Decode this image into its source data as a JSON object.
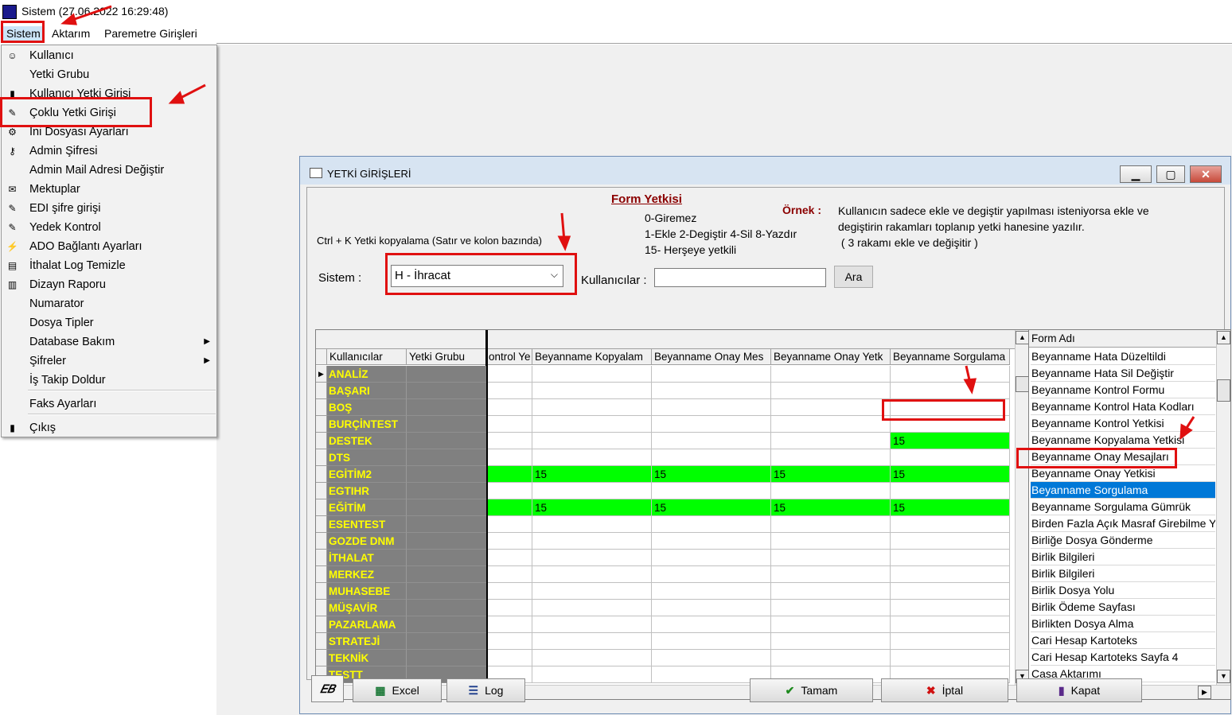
{
  "app": {
    "title": "Sistem (27.06.2022 16:29:48)"
  },
  "menubar": [
    "Sistem",
    "Aktarım",
    "Paremetre Girişleri"
  ],
  "dropdown": [
    {
      "label": "Kullanıcı",
      "icon": "user-icon"
    },
    {
      "label": "Yetki Grubu",
      "icon": ""
    },
    {
      "label": "Kullanıcı Yetki Girişi",
      "icon": "bottle-icon"
    },
    {
      "label": "Çoklu Yetki Girişi",
      "icon": "tools-icon"
    },
    {
      "label": "Ini Dosyası  Ayarları",
      "icon": "settings-icon"
    },
    {
      "label": "Admin Şifresi",
      "icon": "key-icon"
    },
    {
      "label": "Admin Mail Adresi Değiştir",
      "icon": ""
    },
    {
      "label": "Mektuplar",
      "icon": "letter-icon"
    },
    {
      "label": "EDI şifre girişi",
      "icon": "tools-icon"
    },
    {
      "label": "Yedek Kontrol",
      "icon": "tools-icon"
    },
    {
      "label": "ADO Bağlantı Ayarları",
      "icon": "plug-icon"
    },
    {
      "label": "İthalat Log Temizle",
      "icon": "clean-icon"
    },
    {
      "label": "Dizayn Raporu",
      "icon": "report-icon"
    },
    {
      "label": "Numarator",
      "icon": ""
    },
    {
      "label": "Dosya Tipler",
      "icon": ""
    },
    {
      "label": "Database Bakım",
      "icon": "",
      "submenu": true
    },
    {
      "label": "Şifreler",
      "icon": "",
      "submenu": true
    },
    {
      "label": "İş Takip Doldur",
      "icon": ""
    },
    {
      "label": "Faks Ayarları",
      "icon": ""
    },
    {
      "label": "Çıkış",
      "icon": "exit-icon"
    }
  ],
  "dialog": {
    "title": "YETKİ GİRİŞLERİ",
    "form_yetkisi": "Form Yetkisi",
    "legend": [
      "0-Giremez",
      "1-Ekle  2-Degiştir  4-Sil  8-Yazdır",
      "15- Herşeye yetkili"
    ],
    "ornek_label": "Örnek :",
    "ornek_text": [
      "Kullanıcın sadece ekle ve degiştir yapılması isteniyorsa  ekle ve",
      "degiştirin rakamları toplanıp yetki hanesine yazılır.",
      " ( 3 rakamı ekle ve değişitir )"
    ],
    "copy_hint": "Ctrl + K Yetki kopyalama (Satır ve kolon bazında)",
    "sistem_label": "Sistem :",
    "sistem_value": "H - İhracat",
    "kullanicilar_label": "Kullanıcılar :",
    "kullanicilar_value": "",
    "ara_button": "Ara",
    "grid_headers": [
      "Kullanıcılar",
      "Yetki Grubu",
      "ontrol Ye",
      "Beyanname Kopyalam",
      "Beyanname Onay Mes",
      "Beyanname Onay Yetk",
      "Beyanname Sorgulama"
    ],
    "grid_rows": [
      {
        "user": "ANALİZ",
        "vals": [
          "",
          "",
          "",
          "",
          ""
        ]
      },
      {
        "user": "BAŞARI",
        "vals": [
          "",
          "",
          "",
          "",
          ""
        ]
      },
      {
        "user": "BOŞ",
        "vals": [
          "",
          "",
          "",
          "",
          ""
        ]
      },
      {
        "user": "BURÇİNTEST",
        "vals": [
          "",
          "",
          "",
          "",
          ""
        ]
      },
      {
        "user": "DESTEK",
        "vals": [
          "",
          "",
          "",
          "",
          "15"
        ]
      },
      {
        "user": "DTS",
        "vals": [
          "",
          "",
          "",
          "",
          ""
        ]
      },
      {
        "user": "EGİTİM2",
        "vals": [
          "",
          "15",
          "15",
          "15",
          "15"
        ]
      },
      {
        "user": "EGTIHR",
        "vals": [
          "",
          "",
          "",
          "",
          ""
        ]
      },
      {
        "user": "EĞİTİM",
        "vals": [
          "",
          "15",
          "15",
          "15",
          "15"
        ]
      },
      {
        "user": "ESENTEST",
        "vals": [
          "",
          "",
          "",
          "",
          ""
        ]
      },
      {
        "user": "GOZDE DNM",
        "vals": [
          "",
          "",
          "",
          "",
          ""
        ]
      },
      {
        "user": "İTHALAT",
        "vals": [
          "",
          "",
          "",
          "",
          ""
        ]
      },
      {
        "user": "MERKEZ",
        "vals": [
          "",
          "",
          "",
          "",
          ""
        ]
      },
      {
        "user": "MUHASEBE",
        "vals": [
          "",
          "",
          "",
          "",
          ""
        ]
      },
      {
        "user": "MÜŞAVİR",
        "vals": [
          "",
          "",
          "",
          "",
          ""
        ]
      },
      {
        "user": "PAZARLAMA",
        "vals": [
          "",
          "",
          "",
          "",
          ""
        ]
      },
      {
        "user": "STRATEJİ",
        "vals": [
          "",
          "",
          "",
          "",
          ""
        ]
      },
      {
        "user": "TEKNİK",
        "vals": [
          "",
          "",
          "",
          "",
          ""
        ]
      },
      {
        "user": "TESTT",
        "vals": [
          "",
          "",
          "",
          "",
          ""
        ]
      }
    ],
    "form_list_header": "Form Adı",
    "form_list": [
      "Beyanname Hata Düzeltildi",
      "Beyanname Hata Sil Değiştir",
      "Beyanname Kontrol Formu",
      "Beyanname Kontrol Hata Kodları",
      "Beyanname Kontrol Yetkisi",
      "Beyanname Kopyalama Yetkisi",
      "Beyanname Onay Mesajları",
      "Beyanname Onay Yetkisi",
      "Beyanname Sorgulama",
      "Beyanname Sorgulama Gümrük",
      "Birden Fazla Açık Masraf Girebilme Yetkisi",
      "Birliğe Dosya Gönderme",
      "Birlik Bilgileri",
      "Birlik Bilgileri",
      "Birlik Dosya Yolu",
      "Birlik Ödeme Sayfası",
      "Birlikten Dosya Alma",
      "Cari Hesap Kartoteks",
      "Cari Hesap Kartoteks Sayfa 4",
      "Casa Aktarımı"
    ],
    "form_list_selected": "Beyanname Sorgulama",
    "buttons": {
      "excel": "Excel",
      "log": "Log",
      "tamam": "Tamam",
      "iptal": "İptal",
      "kapat": "Kapat"
    }
  },
  "colors": {
    "grant": "#00ff00",
    "user_text": "#ffff00",
    "user_bg": "#808080",
    "highlight": "#e01010",
    "selection": "#0078d7"
  }
}
